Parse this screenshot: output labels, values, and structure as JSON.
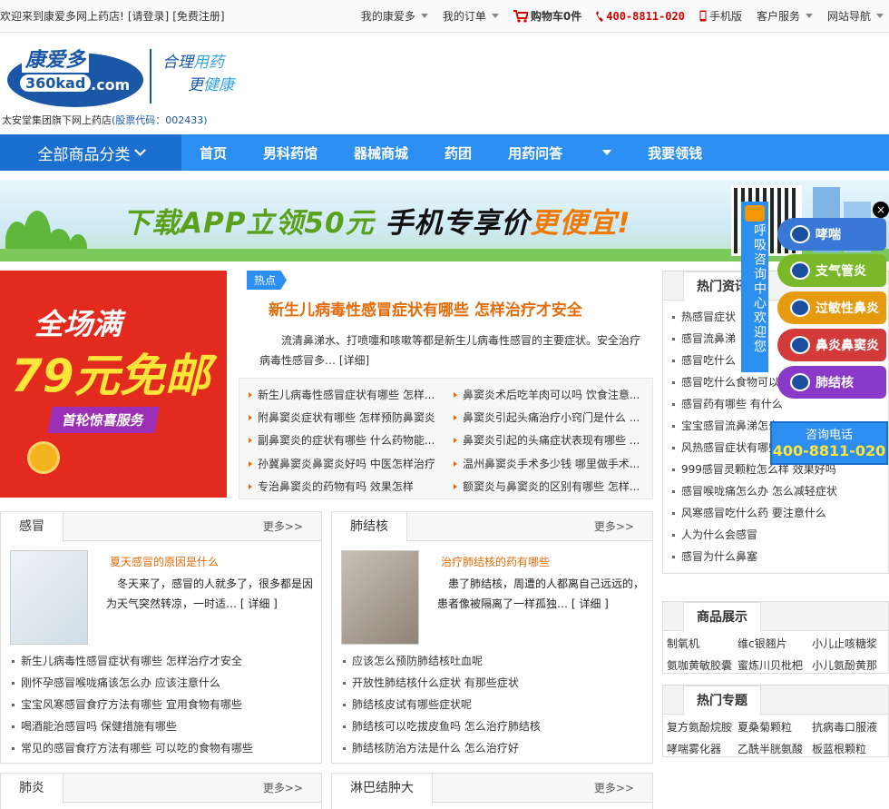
{
  "topbar": {
    "welcome": "欢迎来到康爱多网上药店!",
    "login": "[请登录]",
    "register": "[免费注册]",
    "my_kad": "我的康爱多",
    "my_orders": "我的订单",
    "cart": "购物车0件",
    "phone": "400-8811-020",
    "mobile": "手机版",
    "service": "客户服务",
    "site_nav": "网站导航"
  },
  "header": {
    "logo_cn": "康爱多",
    "logo_en": "360kad",
    "logo_com": ".com",
    "slogan_1a": "合理",
    "slogan_1b": "用药",
    "slogan_2a": "更",
    "slogan_2b": "健康",
    "corp": "太安堂集团旗下网上药店",
    "stock_code": "(股票代码：002433)"
  },
  "nav": {
    "all_categories": "全部商品分类",
    "links": [
      "首页",
      "男科药馆",
      "器械商城",
      "药团",
      "用药问答",
      "我要领钱"
    ]
  },
  "banner": {
    "t1": "下载APP立领50元",
    "t2": "手机专享价",
    "t3": "更便宜!"
  },
  "promo": {
    "line1": "全场满",
    "line2": "79元免邮",
    "line3": "首轮惊喜服务"
  },
  "hot": {
    "badge": "热点",
    "title": "新生儿病毒性感冒症状有哪些 怎样治疗才安全",
    "desc": "流清鼻涕水、打喷嚏和咳嗽等都是新生儿病毒性感冒的主要症状。安全治疗病毒性感冒多…",
    "more": "[详细]",
    "list": [
      "新生儿病毒性感冒症状有哪些 怎样...",
      "鼻窦炎术后吃羊肉可以吗 饮食注意...",
      "附鼻窦炎症状有哪些 怎样预防鼻窦炎",
      "鼻窦炎引起头痛治疗小窍门是什么 ...",
      "副鼻窦炎的症状有哪些 什么药物能...",
      "鼻窦炎引起的头痛症状表现有哪些 ...",
      "孙冀鼻窦炎鼻窦炎好吗 中医怎样治疗",
      "温州鼻窦炎手术多少钱 哪里做手术...",
      "专治鼻窦炎的药物有吗 效果怎样",
      "额窦炎与鼻窦炎的区别有哪些 怎样..."
    ]
  },
  "hot_news": {
    "title": "热门资讯",
    "items": [
      "热感冒症状",
      "感冒流鼻涕",
      "感冒吃什么",
      "感冒吃什么食物可以",
      "感冒药有哪些 有什么",
      "宝宝感冒流鼻涕怎么",
      "风热感冒症状有哪些",
      "999感冒灵颗粒怎么样 效果好吗",
      "感冒喉咙痛怎么办 怎么减轻症状",
      "风寒感冒吃什么药 要注意什么",
      "人为什么会感冒",
      "感冒为什么鼻塞"
    ]
  },
  "products": {
    "title": "商品展示",
    "items": [
      "制氧机",
      "维c银翘片",
      "小儿止咳糖浆",
      "氨咖黄敏胶囊",
      "蜜炼川贝枇杷",
      "小儿氨酚黄那"
    ]
  },
  "topics": {
    "title": "热门专题",
    "items": [
      "复方氨酚烷胺",
      "夏桑菊颗粒",
      "抗病毒口服液",
      "哮喘雾化器",
      "乙酰半胱氨酸",
      "板蓝根颗粒"
    ]
  },
  "float": {
    "side": "呼吸咨询中心欢迎您",
    "close": "×",
    "pills": [
      "哮喘",
      "支气管炎",
      "过敏性鼻炎",
      "鼻炎鼻窦炎",
      "肺结核"
    ],
    "tel_label": "咨询电话",
    "tel": "400-8811-020",
    "colors": [
      "#3a78d8",
      "#7ab82a",
      "#e59a10",
      "#d33a3a",
      "#8a3ac8"
    ]
  },
  "categories": [
    {
      "name": "感冒",
      "more": "更多>>",
      "feature_title": "夏天感冒的原因是什么",
      "feature_desc": "冬天来了，感冒的人就多了，很多都是因为天气突然转凉，一时适…",
      "detail": "[ 详细 ]",
      "items": [
        "新生儿病毒性感冒症状有哪些 怎样治疗才安全",
        "刚怀孕感冒喉咙痛该怎么办 应该注意什么",
        "宝宝风寒感冒食疗方法有哪些 宜用食物有哪些",
        "喝酒能治感冒吗 保健措施有哪些",
        "常见的感冒食疗方法有哪些 可以吃的食物有哪些"
      ]
    },
    {
      "name": "肺结核",
      "more": "更多>>",
      "feature_title": "治疗肺结核的药有哪些",
      "feature_desc": "患了肺结核，周遭的人都离自己远远的，患者像被隔离了一样孤独…",
      "detail": "[ 详细 ]",
      "items": [
        "应该怎么预防肺结核吐血呢",
        "开放性肺结核什么症状 有那些症状",
        "肺结核皮试有哪些症状呢",
        "肺结核可以吃拔皮鱼吗 怎么治疗肺结核",
        "肺结核防治方法是什么 怎么治疗好"
      ]
    },
    {
      "name": "肺炎",
      "more": "更多>>"
    },
    {
      "name": "淋巴结肿大",
      "more": "更多>>"
    }
  ]
}
